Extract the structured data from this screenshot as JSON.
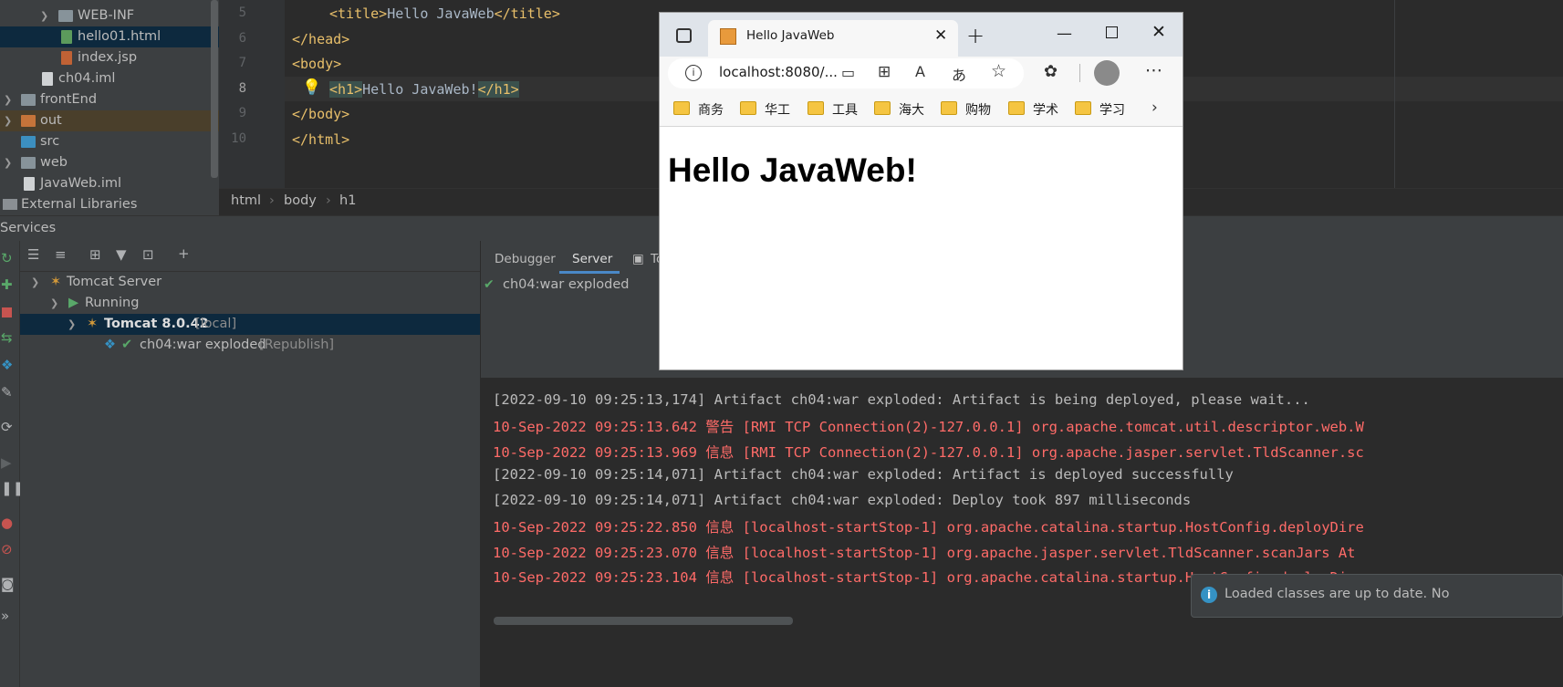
{
  "project_tree": {
    "items": [
      {
        "label": "WEB-INF"
      },
      {
        "label": "hello01.html"
      },
      {
        "label": "index.jsp"
      },
      {
        "label": "ch04.iml"
      },
      {
        "label": "frontEnd"
      },
      {
        "label": "out"
      },
      {
        "label": "src"
      },
      {
        "label": "web"
      },
      {
        "label": "JavaWeb.iml"
      },
      {
        "label": "External Libraries"
      }
    ]
  },
  "editor": {
    "line_numbers": [
      "5",
      "6",
      "7",
      "8",
      "9",
      "10"
    ],
    "lines": [
      {
        "tag_open": "<title>",
        "text": "Hello JavaWeb",
        "tag_close": "</title>"
      },
      {
        "tag_open": "</head>"
      },
      {
        "tag_open": "<body>"
      },
      {
        "tag_open": "<h1>",
        "text": "Hello JavaWeb!",
        "tag_close": "</h1>"
      },
      {
        "tag_open": "</body>"
      },
      {
        "tag_open": "</html>"
      }
    ]
  },
  "breadcrumb": {
    "items": [
      "html",
      "body",
      "h1"
    ],
    "separator": "›"
  },
  "services": {
    "title": "Services",
    "tree": {
      "server": "Tomcat Server",
      "running": "Running",
      "instance": "Tomcat 8.0.42",
      "instance_suffix": "[local]",
      "artifact": "ch04:war exploded",
      "artifact_suffix": "[Republish]"
    },
    "tabs": [
      "Debugger",
      "Server",
      "To"
    ],
    "deployment": "ch04:war exploded",
    "log": [
      {
        "level": "info",
        "text": "[2022-09-10 09:25:13,174] Artifact ch04:war exploded: Artifact is being deployed, please wait..."
      },
      {
        "level": "red",
        "text": "10-Sep-2022 09:25:13.642 警告 [RMI TCP Connection(2)-127.0.0.1] org.apache.tomcat.util.descriptor.web.W"
      },
      {
        "level": "red",
        "text": "10-Sep-2022 09:25:13.969 信息 [RMI TCP Connection(2)-127.0.0.1] org.apache.jasper.servlet.TldScanner.sc"
      },
      {
        "level": "info",
        "text": "[2022-09-10 09:25:14,071] Artifact ch04:war exploded: Artifact is deployed successfully"
      },
      {
        "level": "info",
        "text": "[2022-09-10 09:25:14,071] Artifact ch04:war exploded: Deploy took 897 milliseconds"
      },
      {
        "level": "red",
        "text": "10-Sep-2022 09:25:22.850 信息 [localhost-startStop-1] org.apache.catalina.startup.HostConfig.deployDire"
      },
      {
        "level": "red",
        "text": "10-Sep-2022 09:25:23.070 信息 [localhost-startStop-1] org.apache.jasper.servlet.TldScanner.scanJars At"
      },
      {
        "level": "red",
        "text": "10-Sep-2022 09:25:23.104 信息 [localhost-startStop-1] org.apache.catalina.startup.HostConfig.deployDire"
      }
    ]
  },
  "browser": {
    "tab_title": "Hello JavaWeb",
    "url": "localhost:8080/...",
    "bookmarks": [
      "商务",
      "华工",
      "工具",
      "海大",
      "购物",
      "学术",
      "学习"
    ],
    "page_heading": "Hello JavaWeb!"
  },
  "toast": {
    "text": "Loaded classes are up to date. No"
  },
  "colors": {
    "ide_bg": "#2b2b2b",
    "panel_bg": "#3c3f41",
    "selection": "#0d293e",
    "tag": "#e8bf6a",
    "log_red": "#ff6b68",
    "success_green": "#59a869"
  }
}
